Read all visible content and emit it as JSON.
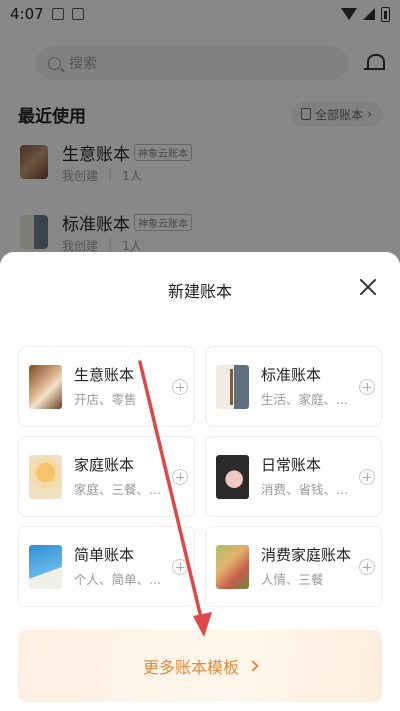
{
  "status_bar": {
    "time": "4:07"
  },
  "search": {
    "placeholder": "搜索"
  },
  "recent": {
    "title": "最近使用",
    "all_label": "全部账本",
    "items": [
      {
        "name": "生意账本",
        "tag": "神象云账本",
        "creator": "我创建",
        "members": "1人"
      },
      {
        "name": "标准账本",
        "tag": "神象云账本",
        "creator": "我创建",
        "members": "1人"
      }
    ]
  },
  "sheet": {
    "title": "新建账本",
    "cards": [
      {
        "name": "生意账本",
        "desc": "开店、零售"
      },
      {
        "name": "标准账本",
        "desc": "生活、家庭、..."
      },
      {
        "name": "家庭账本",
        "desc": "家庭、三餐、..."
      },
      {
        "name": "日常账本",
        "desc": "消费、省钱、..."
      },
      {
        "name": "简单账本",
        "desc": "个人、简单、..."
      },
      {
        "name": "消费家庭账本",
        "desc": "人情、三餐"
      }
    ],
    "more_label": "更多账本模板"
  },
  "colors": {
    "accent": "#e08a3e",
    "annotation_arrow": "#e04848"
  }
}
